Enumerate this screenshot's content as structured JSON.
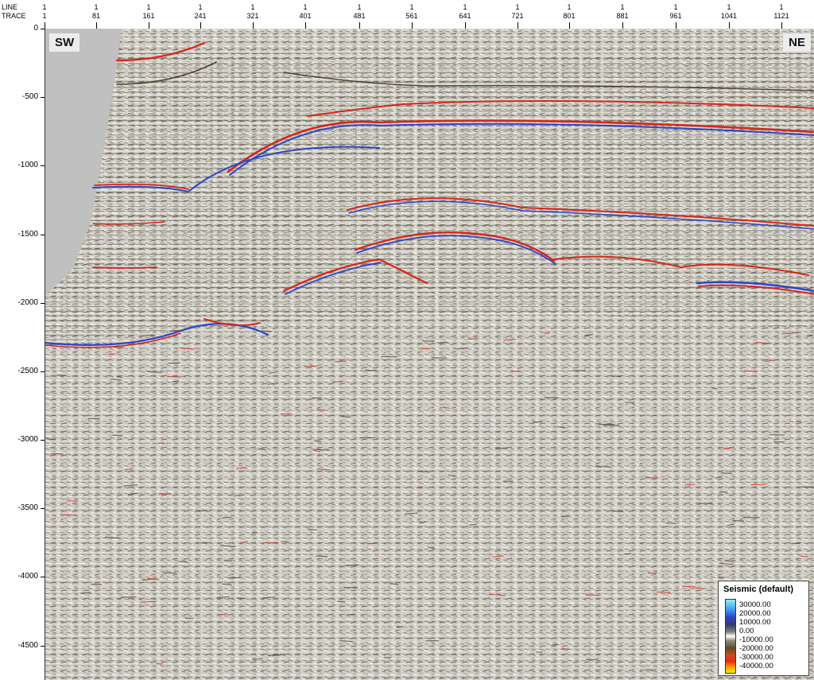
{
  "header": {
    "line_label": "LINE",
    "trace_label": "TRACE",
    "columns": [
      {
        "line": "1",
        "trace": "1"
      },
      {
        "line": "1",
        "trace": "81"
      },
      {
        "line": "1",
        "trace": "161"
      },
      {
        "line": "1",
        "trace": "241"
      },
      {
        "line": "1",
        "trace": "321"
      },
      {
        "line": "1",
        "trace": "401"
      },
      {
        "line": "1",
        "trace": "481"
      },
      {
        "line": "1",
        "trace": "561"
      },
      {
        "line": "1",
        "trace": "641"
      },
      {
        "line": "1",
        "trace": "721"
      },
      {
        "line": "1",
        "trace": "801"
      },
      {
        "line": "1",
        "trace": "881"
      },
      {
        "line": "1",
        "trace": "961"
      },
      {
        "line": "1",
        "trace": "1041"
      },
      {
        "line": "1",
        "trace": "1121"
      }
    ]
  },
  "y_axis": {
    "labels": [
      "0",
      "-500",
      "-1000",
      "-1500",
      "-2000",
      "-2500",
      "-3000",
      "-3500",
      "-4000",
      "-4500"
    ]
  },
  "section": {
    "left_tag": "SW",
    "right_tag": "NE"
  },
  "legend": {
    "title": "Seismic (default)",
    "items": [
      "30000.00",
      "20000.00",
      "10000.00",
      "0.00",
      "-10000.00",
      "-20000.00",
      "-30000.00",
      "-40000.00"
    ]
  },
  "colors": {
    "background": "#cdcbc3",
    "peak": "#2a45cc",
    "trough": "#d8261a",
    "dark": "#4d3f28",
    "mask": "#c0c0c0"
  }
}
